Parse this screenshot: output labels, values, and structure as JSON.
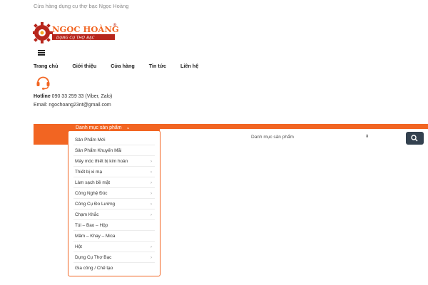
{
  "topbar": {
    "text": "Cửa hàng dụng cụ thợ bạc Ngọc Hoàng"
  },
  "logo": {
    "brand": "NGỌC HOÀNG",
    "tagline": "DỤNG CỤ THỢ BẠC",
    "mark": "®"
  },
  "colors": {
    "accent": "#f26522",
    "dark_button": "#33414f",
    "logo_red": "#b8261c"
  },
  "nav": {
    "items": [
      {
        "label": "Trang chủ"
      },
      {
        "label": "Giới thiệu"
      },
      {
        "label": "Cửa hàng"
      },
      {
        "label": "Tin tức"
      },
      {
        "label": "Liên hệ"
      }
    ]
  },
  "contact": {
    "hotline_label": "Hotline",
    "hotline_value": " 090 33 259 33 (Viber, Zalo)",
    "email_label": "Email:",
    "email_value": " ngochoang23nt@gmail.com"
  },
  "category_menu": {
    "trigger_label": "Danh mục sản phẩm",
    "items": [
      {
        "label": "Sản Phẩm Mới",
        "has_submenu": false
      },
      {
        "label": "Sản Phẩm Khuyến Mãi",
        "has_submenu": false
      },
      {
        "label": "Máy móc thiết bị kim hoàn",
        "has_submenu": true
      },
      {
        "label": "Thiết bị xi mạ",
        "has_submenu": true
      },
      {
        "label": "Làm sạch bề mặt",
        "has_submenu": true
      },
      {
        "label": "Công Nghệ Đúc",
        "has_submenu": true
      },
      {
        "label": "Công Cụ Đo Lường",
        "has_submenu": true
      },
      {
        "label": "Chạm Khắc",
        "has_submenu": true
      },
      {
        "label": "Túi – Bao – Hộp",
        "has_submenu": false
      },
      {
        "label": "Mâm – Khay – Mica",
        "has_submenu": false
      },
      {
        "label": "Hột",
        "has_submenu": true
      },
      {
        "label": "Dụng Cụ Thợ Bạc",
        "has_submenu": true
      },
      {
        "label": "Gia công / Chế tạo",
        "has_submenu": false
      }
    ]
  },
  "search": {
    "category_select": "Danh mục sản phẩm",
    "icon": "search-icon"
  }
}
